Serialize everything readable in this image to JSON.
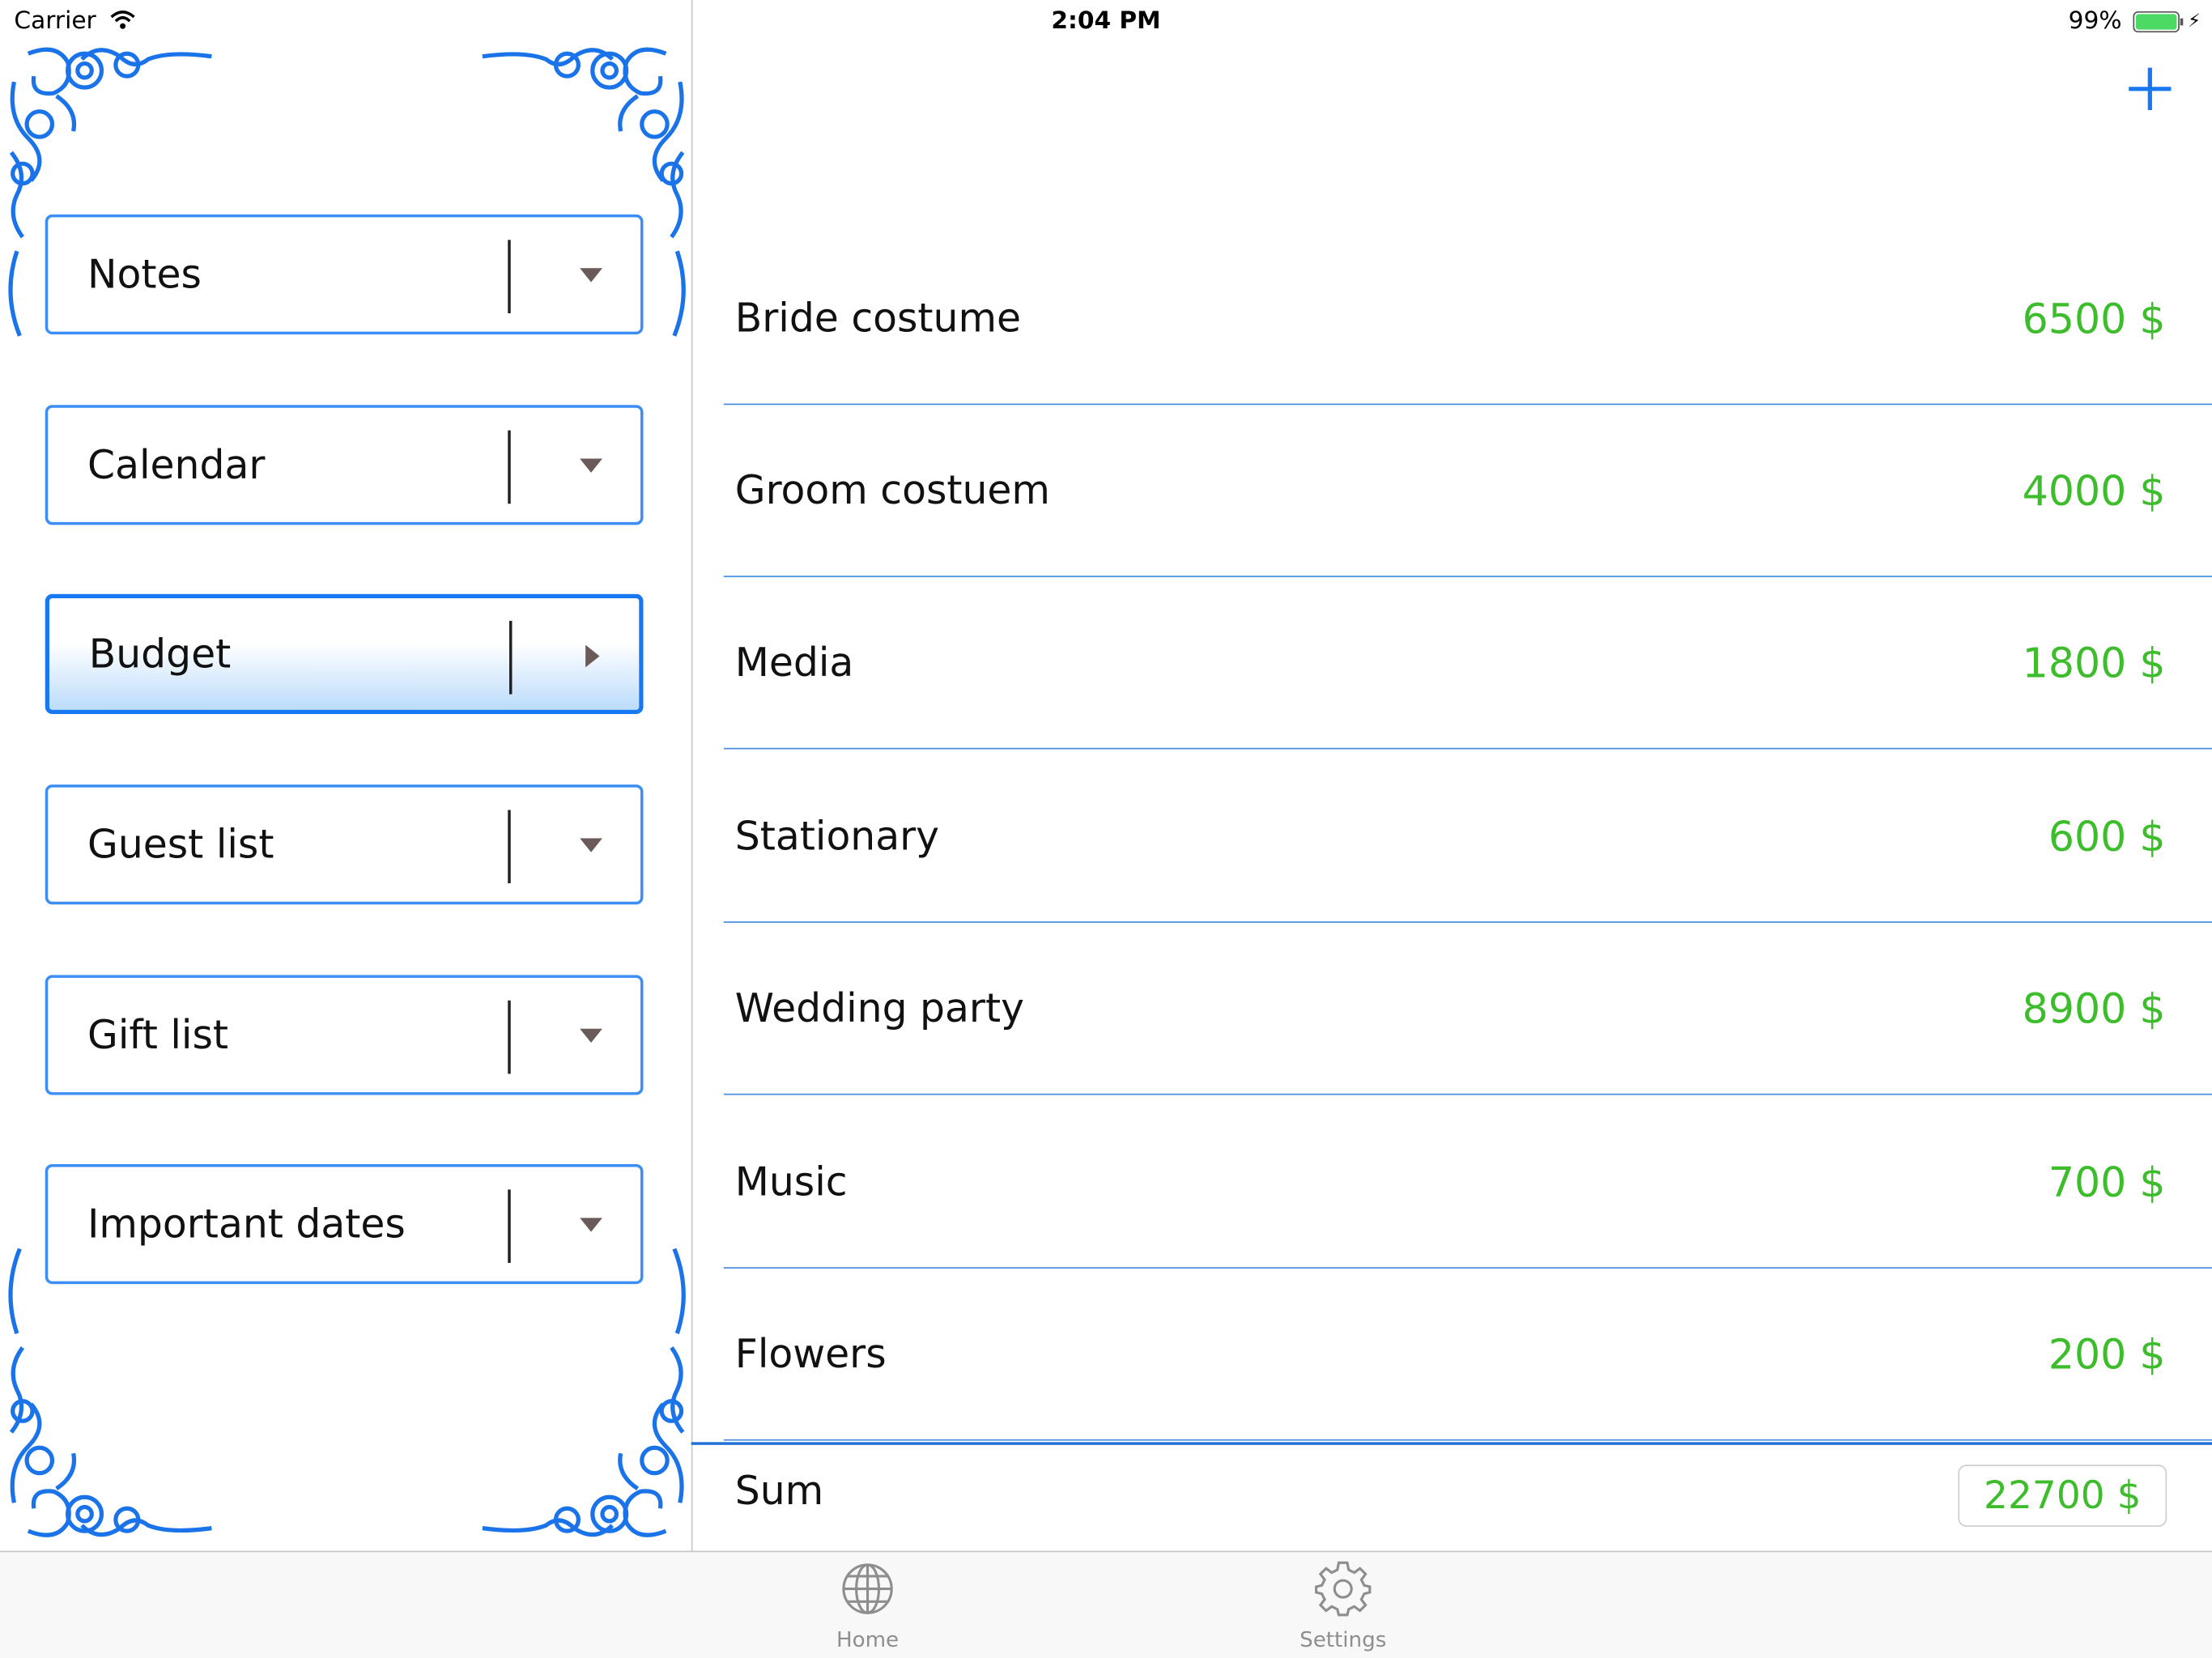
{
  "status_bar": {
    "carrier": "Carrier",
    "time": "2:04 PM",
    "battery": "99%"
  },
  "sidebar": {
    "items": [
      {
        "label": "Notes",
        "icon": "caret-down-icon"
      },
      {
        "label": "Calendar",
        "icon": "caret-down-icon"
      },
      {
        "label": "Budget",
        "icon": "caret-right-icon",
        "selected": true
      },
      {
        "label": "Guest list",
        "icon": "caret-down-icon"
      },
      {
        "label": "Gift list",
        "icon": "caret-down-icon"
      },
      {
        "label": "Important dates",
        "icon": "caret-down-icon"
      }
    ]
  },
  "budget": {
    "add_icon": "plus-icon",
    "rows": [
      {
        "name": "Bride costume",
        "value": "6500 $"
      },
      {
        "name": "Groom costuem",
        "value": "4000 $"
      },
      {
        "name": "Media",
        "value": "1800 $"
      },
      {
        "name": "Stationary",
        "value": "600 $"
      },
      {
        "name": "Wedding party",
        "value": "8900 $"
      },
      {
        "name": "Music",
        "value": "700 $"
      },
      {
        "name": "Flowers",
        "value": "200 $"
      }
    ],
    "sum_label": "Sum",
    "sum_value": "22700 $"
  },
  "tab_bar": {
    "tabs": [
      {
        "label": "Home",
        "icon": "globe-icon"
      },
      {
        "label": "Settings",
        "icon": "gear-icon"
      }
    ]
  },
  "colors": {
    "accent": "#1877f2",
    "value_green": "#3dbd2c",
    "ornament_blue": "#1a73e8",
    "tab_gray": "#8e8e8e"
  }
}
